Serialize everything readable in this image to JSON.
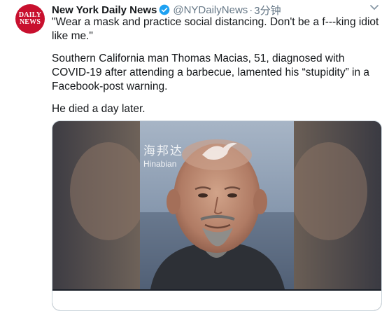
{
  "tweet": {
    "avatar": {
      "line1": "DAILY",
      "line2": "NEWS",
      "color": "#c8102e"
    },
    "author_name": "New York Daily News",
    "handle": "@NYDailyNews",
    "separator": "·",
    "time": "3分钟",
    "quote": "\"Wear a mask and practice social distancing. Don't be a f---king idiot like me.\"",
    "body": "Southern California man Thomas Macias, 51, diagnosed with COVID-19 after attending a barbecue, lamented his “stupidity” in a Facebook-post warning.",
    "died": "He died a day later.",
    "media": {
      "watermark_cn": "海邦达",
      "watermark_en": "Hinabian"
    }
  }
}
